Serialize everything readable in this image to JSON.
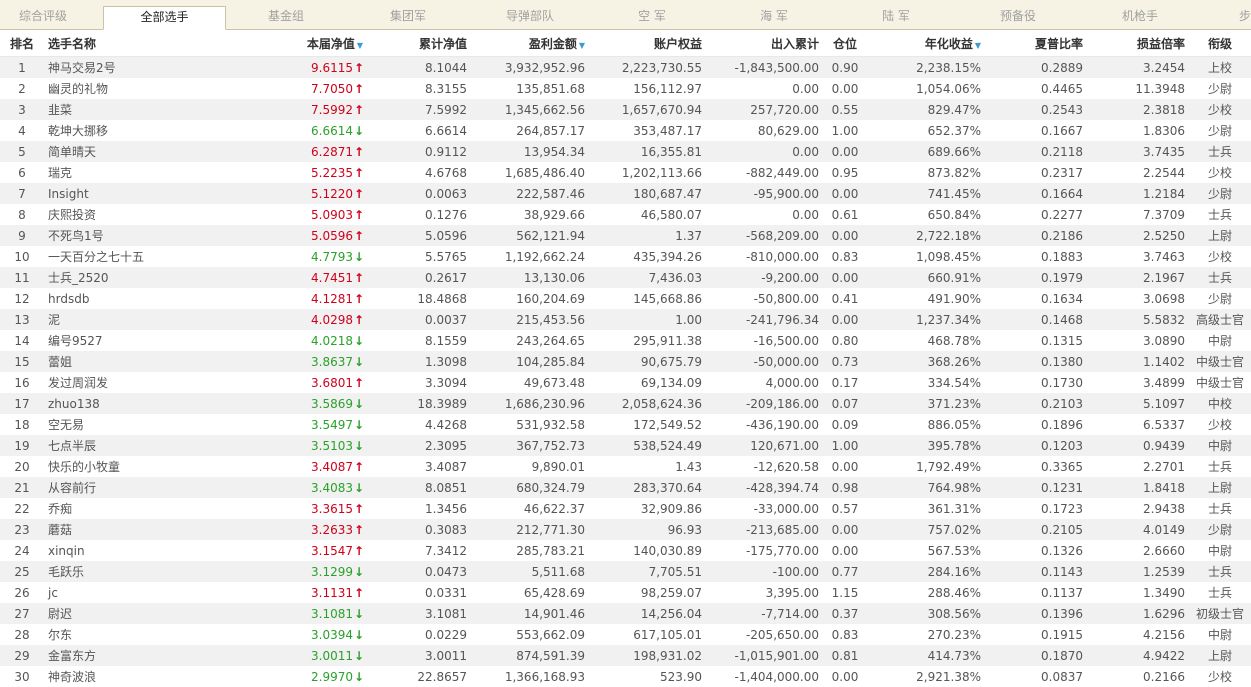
{
  "tabs": [
    "综合评级",
    "全部选手",
    "基金组",
    "集团军",
    "导弹部队",
    "空 军",
    "海 军",
    "陆 军",
    "预备役",
    "机枪手",
    "步"
  ],
  "active_tab": 1,
  "columns": [
    "排名",
    "选手名称",
    "本届净值",
    "累计净值",
    "盈利金额",
    "账户权益",
    "出入累计",
    "仓位",
    "年化收益",
    "夏普比率",
    "损益倍率",
    "衔级"
  ],
  "sort_icon": "triangle-down-icon",
  "colors": {
    "up": "#d0021b",
    "down": "#2aa12a",
    "sort": "#3a9bd6"
  },
  "rows": [
    {
      "rank": "1",
      "name": "神马交易2号",
      "nav": "9.6115",
      "dir": "up",
      "cum": "8.1044",
      "profit": "3,932,952.96",
      "equity": "2,223,730.55",
      "flow": "-1,843,500.00",
      "pos": "0.90",
      "annual": "2,238.15%",
      "sharpe": "0.2889",
      "plr": "3.2454",
      "title": "上校"
    },
    {
      "rank": "2",
      "name": "幽灵的礼物",
      "nav": "7.7050",
      "dir": "up",
      "cum": "8.3155",
      "profit": "135,851.68",
      "equity": "156,112.97",
      "flow": "0.00",
      "pos": "0.00",
      "annual": "1,054.06%",
      "sharpe": "0.4465",
      "plr": "11.3948",
      "title": "少尉"
    },
    {
      "rank": "3",
      "name": "韭菜",
      "nav": "7.5992",
      "dir": "up",
      "cum": "7.5992",
      "profit": "1,345,662.56",
      "equity": "1,657,670.94",
      "flow": "257,720.00",
      "pos": "0.55",
      "annual": "829.47%",
      "sharpe": "0.2543",
      "plr": "2.3818",
      "title": "少校"
    },
    {
      "rank": "4",
      "name": "乾坤大挪移",
      "nav": "6.6614",
      "dir": "down",
      "cum": "6.6614",
      "profit": "264,857.17",
      "equity": "353,487.17",
      "flow": "80,629.00",
      "pos": "1.00",
      "annual": "652.37%",
      "sharpe": "0.1667",
      "plr": "1.8306",
      "title": "少尉"
    },
    {
      "rank": "5",
      "name": "简单晴天",
      "nav": "6.2871",
      "dir": "up",
      "cum": "0.9112",
      "profit": "13,954.34",
      "equity": "16,355.81",
      "flow": "0.00",
      "pos": "0.00",
      "annual": "689.66%",
      "sharpe": "0.2118",
      "plr": "3.7435",
      "title": "士兵"
    },
    {
      "rank": "6",
      "name": "瑞克",
      "nav": "5.2235",
      "dir": "up",
      "cum": "4.6768",
      "profit": "1,685,486.40",
      "equity": "1,202,113.66",
      "flow": "-882,449.00",
      "pos": "0.95",
      "annual": "873.82%",
      "sharpe": "0.2317",
      "plr": "2.2544",
      "title": "少校"
    },
    {
      "rank": "7",
      "name": "Insight",
      "nav": "5.1220",
      "dir": "up",
      "cum": "0.0063",
      "profit": "222,587.46",
      "equity": "180,687.47",
      "flow": "-95,900.00",
      "pos": "0.00",
      "annual": "741.45%",
      "sharpe": "0.1664",
      "plr": "1.2184",
      "title": "少尉"
    },
    {
      "rank": "8",
      "name": "庆熙投资",
      "nav": "5.0903",
      "dir": "up",
      "cum": "0.1276",
      "profit": "38,929.66",
      "equity": "46,580.07",
      "flow": "0.00",
      "pos": "0.61",
      "annual": "650.84%",
      "sharpe": "0.2277",
      "plr": "7.3709",
      "title": "士兵"
    },
    {
      "rank": "9",
      "name": "不死鸟1号",
      "nav": "5.0596",
      "dir": "up",
      "cum": "5.0596",
      "profit": "562,121.94",
      "equity": "1.37",
      "flow": "-568,209.00",
      "pos": "0.00",
      "annual": "2,722.18%",
      "sharpe": "0.2186",
      "plr": "2.5250",
      "title": "上尉"
    },
    {
      "rank": "10",
      "name": "一天百分之七十五",
      "nav": "4.7793",
      "dir": "down",
      "cum": "5.5765",
      "profit": "1,192,662.24",
      "equity": "435,394.26",
      "flow": "-810,000.00",
      "pos": "0.83",
      "annual": "1,098.45%",
      "sharpe": "0.1883",
      "plr": "3.7463",
      "title": "少校"
    },
    {
      "rank": "11",
      "name": "士兵_2520",
      "nav": "4.7451",
      "dir": "up",
      "cum": "0.2617",
      "profit": "13,130.06",
      "equity": "7,436.03",
      "flow": "-9,200.00",
      "pos": "0.00",
      "annual": "660.91%",
      "sharpe": "0.1979",
      "plr": "2.1967",
      "title": "士兵"
    },
    {
      "rank": "12",
      "name": "hrdsdb",
      "nav": "4.1281",
      "dir": "up",
      "cum": "18.4868",
      "profit": "160,204.69",
      "equity": "145,668.86",
      "flow": "-50,800.00",
      "pos": "0.41",
      "annual": "491.90%",
      "sharpe": "0.1634",
      "plr": "3.0698",
      "title": "少尉"
    },
    {
      "rank": "13",
      "name": "泥",
      "nav": "4.0298",
      "dir": "up",
      "cum": "0.0037",
      "profit": "215,453.56",
      "equity": "1.00",
      "flow": "-241,796.34",
      "pos": "0.00",
      "annual": "1,237.34%",
      "sharpe": "0.1468",
      "plr": "5.5832",
      "title": "高级士官"
    },
    {
      "rank": "14",
      "name": "编号9527",
      "nav": "4.0218",
      "dir": "down",
      "cum": "8.1559",
      "profit": "243,264.65",
      "equity": "295,911.38",
      "flow": "-16,500.00",
      "pos": "0.80",
      "annual": "468.78%",
      "sharpe": "0.1315",
      "plr": "3.0890",
      "title": "中尉"
    },
    {
      "rank": "15",
      "name": "蕾姐",
      "nav": "3.8637",
      "dir": "down",
      "cum": "1.3098",
      "profit": "104,285.84",
      "equity": "90,675.79",
      "flow": "-50,000.00",
      "pos": "0.73",
      "annual": "368.26%",
      "sharpe": "0.1380",
      "plr": "1.1402",
      "title": "中级士官"
    },
    {
      "rank": "16",
      "name": "发过周润发",
      "nav": "3.6801",
      "dir": "up",
      "cum": "3.3094",
      "profit": "49,673.48",
      "equity": "69,134.09",
      "flow": "4,000.00",
      "pos": "0.17",
      "annual": "334.54%",
      "sharpe": "0.1730",
      "plr": "3.4899",
      "title": "中级士官"
    },
    {
      "rank": "17",
      "name": "zhuo138",
      "nav": "3.5869",
      "dir": "down",
      "cum": "18.3989",
      "profit": "1,686,230.96",
      "equity": "2,058,624.36",
      "flow": "-209,186.00",
      "pos": "0.07",
      "annual": "371.23%",
      "sharpe": "0.2103",
      "plr": "5.1097",
      "title": "中校"
    },
    {
      "rank": "18",
      "name": "空无易",
      "nav": "3.5497",
      "dir": "down",
      "cum": "4.4268",
      "profit": "531,932.58",
      "equity": "172,549.52",
      "flow": "-436,190.00",
      "pos": "0.09",
      "annual": "886.05%",
      "sharpe": "0.1896",
      "plr": "6.5337",
      "title": "少校"
    },
    {
      "rank": "19",
      "name": "七点半辰",
      "nav": "3.5103",
      "dir": "down",
      "cum": "2.3095",
      "profit": "367,752.73",
      "equity": "538,524.49",
      "flow": "120,671.00",
      "pos": "1.00",
      "annual": "395.78%",
      "sharpe": "0.1203",
      "plr": "0.9439",
      "title": "中尉"
    },
    {
      "rank": "20",
      "name": "快乐的小牧童",
      "nav": "3.4087",
      "dir": "up",
      "cum": "3.4087",
      "profit": "9,890.01",
      "equity": "1.43",
      "flow": "-12,620.58",
      "pos": "0.00",
      "annual": "1,792.49%",
      "sharpe": "0.3365",
      "plr": "2.2701",
      "title": "士兵"
    },
    {
      "rank": "21",
      "name": "从容前行",
      "nav": "3.4083",
      "dir": "down",
      "cum": "8.0851",
      "profit": "680,324.79",
      "equity": "283,370.64",
      "flow": "-428,394.74",
      "pos": "0.98",
      "annual": "764.98%",
      "sharpe": "0.1231",
      "plr": "1.8418",
      "title": "上尉"
    },
    {
      "rank": "22",
      "name": "乔痴",
      "nav": "3.3615",
      "dir": "up",
      "cum": "1.3456",
      "profit": "46,622.37",
      "equity": "32,909.86",
      "flow": "-33,000.00",
      "pos": "0.57",
      "annual": "361.31%",
      "sharpe": "0.1723",
      "plr": "2.9438",
      "title": "士兵"
    },
    {
      "rank": "23",
      "name": "蘑菇",
      "nav": "3.2633",
      "dir": "up",
      "cum": "0.3083",
      "profit": "212,771.30",
      "equity": "96.93",
      "flow": "-213,685.00",
      "pos": "0.00",
      "annual": "757.02%",
      "sharpe": "0.2105",
      "plr": "4.0149",
      "title": "少尉"
    },
    {
      "rank": "24",
      "name": "xinqin",
      "nav": "3.1547",
      "dir": "up",
      "cum": "7.3412",
      "profit": "285,783.21",
      "equity": "140,030.89",
      "flow": "-175,770.00",
      "pos": "0.00",
      "annual": "567.53%",
      "sharpe": "0.1326",
      "plr": "2.6660",
      "title": "中尉"
    },
    {
      "rank": "25",
      "name": "毛跃乐",
      "nav": "3.1299",
      "dir": "down",
      "cum": "0.0473",
      "profit": "5,511.68",
      "equity": "7,705.51",
      "flow": "-100.00",
      "pos": "0.77",
      "annual": "284.16%",
      "sharpe": "0.1143",
      "plr": "1.2539",
      "title": "士兵"
    },
    {
      "rank": "26",
      "name": "jc",
      "nav": "3.1131",
      "dir": "up",
      "cum": "0.0331",
      "profit": "65,428.69",
      "equity": "98,259.07",
      "flow": "3,395.00",
      "pos": "1.15",
      "annual": "288.46%",
      "sharpe": "0.1137",
      "plr": "1.3490",
      "title": "士兵"
    },
    {
      "rank": "27",
      "name": "尉迟",
      "nav": "3.1081",
      "dir": "down",
      "cum": "3.1081",
      "profit": "14,901.46",
      "equity": "14,256.04",
      "flow": "-7,714.00",
      "pos": "0.37",
      "annual": "308.56%",
      "sharpe": "0.1396",
      "plr": "1.6296",
      "title": "初级士官"
    },
    {
      "rank": "28",
      "name": "尔东",
      "nav": "3.0394",
      "dir": "down",
      "cum": "0.0229",
      "profit": "553,662.09",
      "equity": "617,105.01",
      "flow": "-205,650.00",
      "pos": "0.83",
      "annual": "270.23%",
      "sharpe": "0.1915",
      "plr": "4.2156",
      "title": "中尉"
    },
    {
      "rank": "29",
      "name": "金富东方",
      "nav": "3.0011",
      "dir": "down",
      "cum": "3.0011",
      "profit": "874,591.39",
      "equity": "198,931.02",
      "flow": "-1,015,901.00",
      "pos": "0.81",
      "annual": "414.73%",
      "sharpe": "0.1870",
      "plr": "4.9422",
      "title": "上尉"
    },
    {
      "rank": "30",
      "name": "神奇波浪",
      "nav": "2.9970",
      "dir": "down",
      "cum": "22.8657",
      "profit": "1,366,168.93",
      "equity": "523.90",
      "flow": "-1,404,000.00",
      "pos": "0.00",
      "annual": "2,921.38%",
      "sharpe": "0.0837",
      "plr": "0.2166",
      "title": "少校"
    }
  ]
}
